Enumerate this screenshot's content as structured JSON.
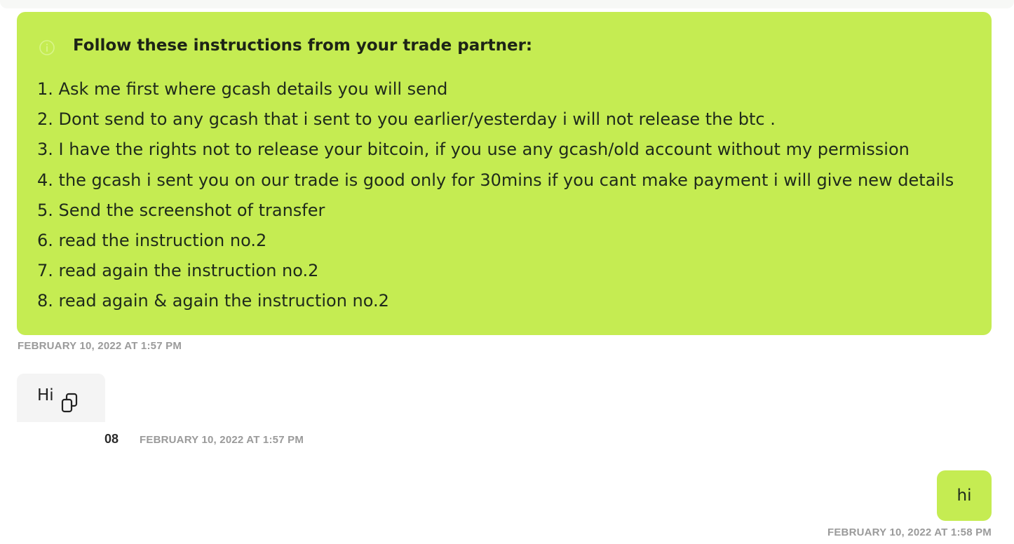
{
  "instructions": {
    "title": "Follow these instructions from your trade partner:",
    "items": [
      "1. Ask me first where gcash details you will send",
      "2. Dont send to any gcash that i sent to you earlier/yesterday i will not release the btc .",
      "3. I have the rights not to release your bitcoin, if you use any gcash/old account without my permission",
      "4. the gcash i sent you on our trade is good only for 30mins if you cant make payment i will give new details",
      "5. Send the screenshot of transfer",
      "6. read the instruction no.2",
      "7. read again the instruction no.2",
      "8. read again & again the instruction no.2"
    ],
    "timestamp": "FEBRUARY 10, 2022 AT 1:57 PM"
  },
  "messages": [
    {
      "text": "Hi",
      "sender": "08",
      "timestamp": "FEBRUARY 10, 2022 AT 1:57 PM"
    },
    {
      "text": "hi",
      "timestamp": "FEBRUARY 10, 2022 AT 1:58 PM"
    }
  ],
  "icons": {
    "info": "info-icon",
    "copy": "copy-icon"
  },
  "colors": {
    "accent": "#c5ec52",
    "incoming_bubble": "#f4f4f4",
    "timestamp": "#9a9a9a"
  }
}
